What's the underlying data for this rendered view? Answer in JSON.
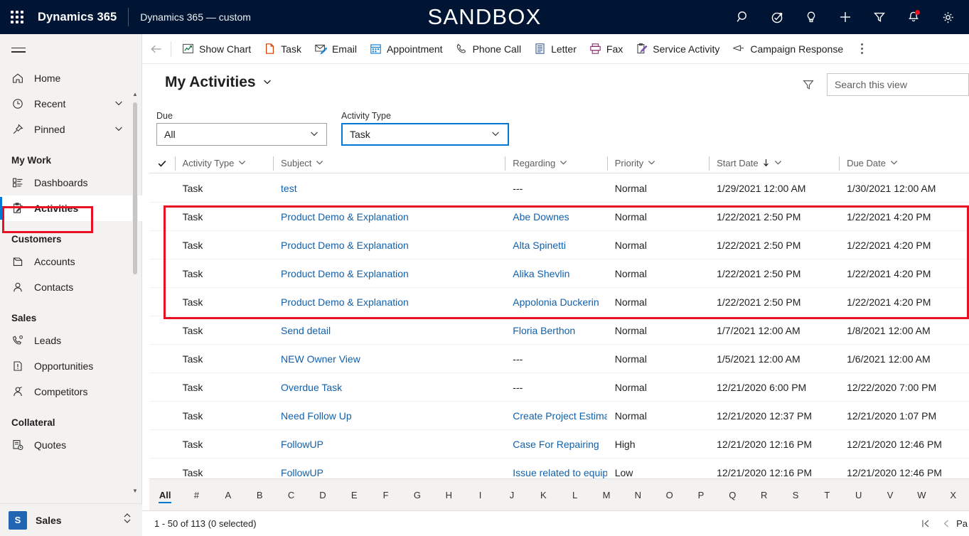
{
  "topbar": {
    "waffle_label": "App launcher",
    "brand": "Dynamics 365",
    "app_name": "Dynamics 365 — custom",
    "environment_banner": "SANDBOX",
    "icons": [
      {
        "name": "search-icon",
        "label": "Search"
      },
      {
        "name": "assistant-icon",
        "label": "Assistant"
      },
      {
        "name": "lightbulb-icon",
        "label": "Tips"
      },
      {
        "name": "quick-create-icon",
        "label": "Quick create"
      },
      {
        "name": "filter-icon",
        "label": "Relevance search filter"
      },
      {
        "name": "notifications-bell-icon",
        "label": "Notifications"
      },
      {
        "name": "settings-gear-icon",
        "label": "Settings"
      }
    ]
  },
  "sidebar": {
    "hamburger_label": "Expand / collapse site map",
    "items": [
      {
        "label": "Home",
        "icon": "home-icon",
        "type": "item",
        "chevron": false
      },
      {
        "label": "Recent",
        "icon": "clock-icon",
        "type": "item",
        "chevron": true
      },
      {
        "label": "Pinned",
        "icon": "pin-icon",
        "type": "item",
        "chevron": true
      },
      {
        "label": "My Work",
        "type": "group"
      },
      {
        "label": "Dashboards",
        "icon": "dashboard-icon",
        "type": "item",
        "chevron": false
      },
      {
        "label": "Activities",
        "icon": "activities-icon",
        "type": "item",
        "chevron": false,
        "active": true
      },
      {
        "label": "Customers",
        "type": "group"
      },
      {
        "label": "Accounts",
        "icon": "accounts-icon",
        "type": "item",
        "chevron": false
      },
      {
        "label": "Contacts",
        "icon": "contact-icon",
        "type": "item",
        "chevron": false
      },
      {
        "label": "Sales",
        "type": "group"
      },
      {
        "label": "Leads",
        "icon": "leads-icon",
        "type": "item",
        "chevron": false
      },
      {
        "label": "Opportunities",
        "icon": "opportunities-icon",
        "type": "item",
        "chevron": false
      },
      {
        "label": "Competitors",
        "icon": "competitors-icon",
        "type": "item",
        "chevron": false
      },
      {
        "label": "Collateral",
        "type": "group"
      },
      {
        "label": "Quotes",
        "icon": "quotes-icon",
        "type": "item",
        "chevron": false
      }
    ],
    "app_switcher": {
      "initial": "S",
      "name": "Sales"
    }
  },
  "commandbar": {
    "back_label": "Back",
    "buttons": [
      {
        "label": "Show Chart",
        "icon": "chart-icon"
      },
      {
        "label": "Task",
        "icon": "task-page-icon"
      },
      {
        "label": "Email",
        "icon": "email-icon"
      },
      {
        "label": "Appointment",
        "icon": "calendar-icon"
      },
      {
        "label": "Phone Call",
        "icon": "phone-icon"
      },
      {
        "label": "Letter",
        "icon": "letter-icon"
      },
      {
        "label": "Fax",
        "icon": "fax-icon"
      },
      {
        "label": "Service Activity",
        "icon": "service-activity-icon"
      },
      {
        "label": "Campaign Response",
        "icon": "campaign-response-icon"
      }
    ],
    "overflow_label": "More commands"
  },
  "view": {
    "title": "My Activities",
    "title_chevron": "chevron-down-icon",
    "filter_icon_label": "Edit filters",
    "search": {
      "value": "",
      "placeholder": "Search this view"
    }
  },
  "filters": [
    {
      "label": "Due",
      "value": "All",
      "focused": false,
      "name": "due-filter"
    },
    {
      "label": "Activity Type",
      "value": "Task",
      "focused": true,
      "name": "activity-type-filter"
    }
  ],
  "grid": {
    "columns": [
      {
        "key": "activity_type",
        "label": "Activity Type",
        "sorted": false
      },
      {
        "key": "subject",
        "label": "Subject",
        "sorted": false
      },
      {
        "key": "regarding",
        "label": "Regarding",
        "sorted": false
      },
      {
        "key": "priority",
        "label": "Priority",
        "sorted": false
      },
      {
        "key": "start_date",
        "label": "Start Date",
        "sorted": true,
        "sort_dir": "desc"
      },
      {
        "key": "due_date",
        "label": "Due Date",
        "sorted": false
      }
    ],
    "rows": [
      {
        "activity_type": "Task",
        "subject": "test",
        "regarding": "---",
        "regarding_link": false,
        "priority": "Normal",
        "start_date": "1/29/2021 12:00 AM",
        "due_date": "1/30/2021 12:00 AM",
        "highlighted": false
      },
      {
        "activity_type": "Task",
        "subject": "Product Demo & Explanation",
        "regarding": "Abe Downes",
        "regarding_link": true,
        "priority": "Normal",
        "start_date": "1/22/2021 2:50 PM",
        "due_date": "1/22/2021 4:20 PM",
        "highlighted": true
      },
      {
        "activity_type": "Task",
        "subject": "Product Demo & Explanation",
        "regarding": "Alta Spinetti",
        "regarding_link": true,
        "priority": "Normal",
        "start_date": "1/22/2021 2:50 PM",
        "due_date": "1/22/2021 4:20 PM",
        "highlighted": true
      },
      {
        "activity_type": "Task",
        "subject": "Product Demo & Explanation",
        "regarding": "Alika Shevlin",
        "regarding_link": true,
        "priority": "Normal",
        "start_date": "1/22/2021 2:50 PM",
        "due_date": "1/22/2021 4:20 PM",
        "highlighted": true
      },
      {
        "activity_type": "Task",
        "subject": "Product Demo & Explanation",
        "regarding": "Appolonia Duckerin",
        "regarding_link": true,
        "priority": "Normal",
        "start_date": "1/22/2021 2:50 PM",
        "due_date": "1/22/2021 4:20 PM",
        "highlighted": true
      },
      {
        "activity_type": "Task",
        "subject": "Send detail",
        "regarding": "Floria Berthon",
        "regarding_link": true,
        "priority": "Normal",
        "start_date": "1/7/2021 12:00 AM",
        "due_date": "1/8/2021 12:00 AM",
        "highlighted": false
      },
      {
        "activity_type": "Task",
        "subject": "NEW Owner View",
        "regarding": "---",
        "regarding_link": false,
        "priority": "Normal",
        "start_date": "1/5/2021 12:00 AM",
        "due_date": "1/6/2021 12:00 AM",
        "highlighted": false
      },
      {
        "activity_type": "Task",
        "subject": "Overdue Task",
        "regarding": "---",
        "regarding_link": false,
        "priority": "Normal",
        "start_date": "12/21/2020 6:00 PM",
        "due_date": "12/22/2020 7:00 PM",
        "highlighted": false
      },
      {
        "activity_type": "Task",
        "subject": "Need Follow Up",
        "regarding": "Create Project Estimati",
        "regarding_link": true,
        "priority": "Normal",
        "start_date": "12/21/2020 12:37 PM",
        "due_date": "12/21/2020 1:07 PM",
        "highlighted": false
      },
      {
        "activity_type": "Task",
        "subject": "FollowUP",
        "regarding": "Case For Repairing",
        "regarding_link": true,
        "priority": "High",
        "start_date": "12/21/2020 12:16 PM",
        "due_date": "12/21/2020 12:46 PM",
        "highlighted": false
      },
      {
        "activity_type": "Task",
        "subject": "FollowUP",
        "regarding": "Issue related to equipm",
        "regarding_link": true,
        "priority": "Low",
        "start_date": "12/21/2020 12:16 PM",
        "due_date": "12/21/2020 12:46 PM",
        "highlighted": false
      }
    ]
  },
  "alpha_filter": {
    "selected": "All",
    "letters": [
      "All",
      "#",
      "A",
      "B",
      "C",
      "D",
      "E",
      "F",
      "G",
      "H",
      "I",
      "J",
      "K",
      "L",
      "M",
      "N",
      "O",
      "P",
      "Q",
      "R",
      "S",
      "T",
      "U",
      "V",
      "W",
      "X"
    ]
  },
  "status": {
    "record_count": "1 - 50 of 113 (0 selected)",
    "pager": {
      "first_label": "First page",
      "previous_label": "Previous page",
      "page_text": "Pa"
    }
  },
  "colors": {
    "topbar_bg": "#001433",
    "accent": "#0078d4",
    "link": "#1160ab",
    "highlight_box": "#e81123",
    "sidebar_bg": "#f3f2f1"
  }
}
